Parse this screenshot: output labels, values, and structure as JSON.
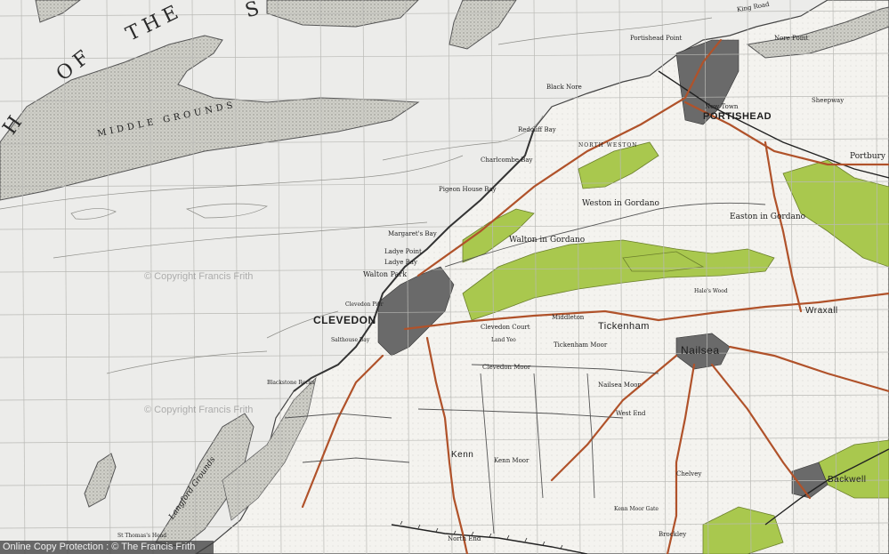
{
  "map": {
    "labels": {
      "sea_the": "THE",
      "sea_of": "OF",
      "sea_s": "S",
      "sea_h": "H",
      "middle_grounds": "MIDDLE GROUNDS",
      "langford_grounds": "Langford Grounds",
      "clevedon": "CLEVEDON",
      "portishead": "PORTISHEAD",
      "nailsea": "Nailsea",
      "tickenham": "Tickenham",
      "kenn": "Kenn",
      "backwell": "Backwell",
      "wraxall": "Wraxall",
      "weston_in_gordano": "Weston in Gordano",
      "walton_in_gordano": "Walton in Gordano",
      "easton_in_gordano": "Easton in Gordano",
      "walton_park": "Walton Park",
      "portbury": "Portbury",
      "portishead_point": "Portishead Point",
      "black_nore": "Black Nore",
      "nore_point": "Nore Point",
      "redcliffe_bay": "Redcliff Bay",
      "charlcombe_bay": "Charlcombe Bay",
      "pigeon_house_bay": "Pigeon House Bay",
      "margarets_bay": "Margaret's Bay",
      "ladye_point": "Ladye Point",
      "ladye_bay": "Ladye Bay",
      "clevedon_pier": "Clevedon Pier",
      "salthouse_bay": "Salthouse Bay",
      "blackstone_rocks": "Blackstone Rocks",
      "clevedon_court": "Clevedon Court",
      "clevedon_moor": "Clevedon Moor",
      "tickenham_moor": "Tickenham Moor",
      "nailsea_moor": "Nailsea Moor",
      "kenn_moor": "Kenn Moor",
      "west_end": "West End",
      "north_weston": "NORTH WESTON",
      "new_town": "New Town",
      "middleton": "Middleton",
      "sheepway": "Sheepway",
      "king_road": "King Road",
      "st_thomas_head": "St Thomas's Head",
      "north_end": "North End",
      "chelvey": "Chelvey",
      "brockley": "Brockley",
      "kenn_moor_gate": "Kenn Moor Gate",
      "yeo": "Land Yeo",
      "hales_wood": "Hale's Wood"
    },
    "watermarks": [
      "© Copyright Francis Frith",
      "© Copyright Francis Frith"
    ],
    "copyright": "Online Copy Protection : © The Francis Frith Collection",
    "colors": {
      "paper": "#ececea",
      "land": "#f3f2ee",
      "sand": "#d2d2cc",
      "woodland": "#a9c84e",
      "road": "#b0522a",
      "urban": "#5d5d5d",
      "grid": "#b9b9b5"
    }
  }
}
